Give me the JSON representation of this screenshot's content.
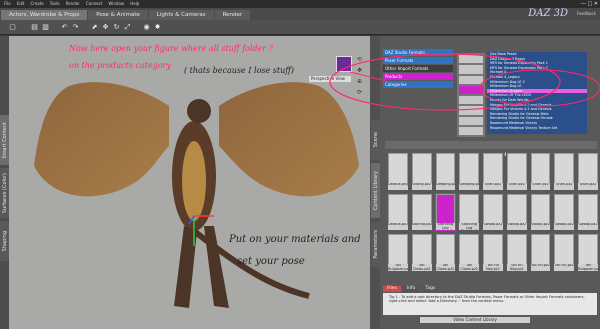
{
  "app": {
    "brand": "DAZ 3D",
    "feedback": "Feedback"
  },
  "menu": [
    "File",
    "Edit",
    "Create",
    "Tools",
    "Render",
    "Connect",
    "Window",
    "Help"
  ],
  "tabs": [
    "Actors, Wardrobe & Props",
    "Pose & Animate",
    "Lights & Cameras",
    "Render"
  ],
  "left_tabs": [
    "Smart Content",
    "Surfaces (Color)",
    "Shaping"
  ],
  "mid_tabs": [
    "Scene",
    "Content Library",
    "Parameters"
  ],
  "viewport": {
    "perspective": "Perspective View"
  },
  "annotations": {
    "top": "Now here open your figure where all stuff folder ?",
    "top2": "on the products category",
    "top3": "( thats because I lose stuff)",
    "bottom": "Put on your materials and",
    "bottom2": "set your pose"
  },
  "tree": [
    "DAZ Studio Formats",
    "Poser Formats",
    "Other Import Formats",
    "Products",
    "Categories"
  ],
  "list": [
    "Daz Base Poses",
    "DAZ Dragon 3 Bases",
    "MFS for Genesis Expansion Pack 1",
    "MFS for Genesis Expansion Pack 2",
    "Michael 4",
    "Michael 4_Legacy",
    "Millennium Dog LE 2",
    "Millennium Dog LE",
    "Millennium Dragon",
    "Millennium Of The LEGO",
    "Moody for Dark Worlds",
    "Morgan For Victoria 4.2 and Genesis",
    "Morgan For Victoria 4.2 and Genesis",
    "Rendering Studio for Genesis Male",
    "Rendering Studio for Genesis Female",
    "Rosamund Medieval Victory",
    "Rosamund Medieval Victory Texture Set"
  ],
  "library": {
    "header": "1 - 54 of 154",
    "rows": [
      [
        "Default.png",
        "Sitting.pz2",
        "Sleeping.pz2",
        "Sleeping.pz2",
        "Snarl.pz2",
        "Snarl.pz2",
        "Snarl.pz2",
        "Snarl.pz2",
        "Snarl.pz2"
      ],
      [
        "Default.pz2",
        "Soaring.pz2",
        "Standing Leg Left.pz2",
        "Standing Leg Right.pz2",
        "Swoop.pz2",
        "Swoop.pz2",
        "Swoop.pz2",
        "Swoop.pz2",
        "Swoop.pz2"
      ],
      [
        "Tail Bulgasm.pz2",
        "Tail Claws.pz2",
        "Tail Claws.pz2",
        "Tail Claws.pz2",
        "Tail Fin Nay.pz2",
        "Tail Fin Nay.pz2",
        "Tail Fin.pz2",
        "Tail Fin.pz2",
        "Tail Bulgasm.pz2"
      ]
    ],
    "selected": [
      1,
      2
    ]
  },
  "bottom_tabs": [
    "Files",
    "Info",
    "Tags"
  ],
  "tip": "Tip 1 - To add a root directory to the DAZ Studio Formats, Poser Formats or Other Import Formats containers, right-click and select 'Add a Directory...' from the context menu.",
  "footer": "Video Content Library"
}
